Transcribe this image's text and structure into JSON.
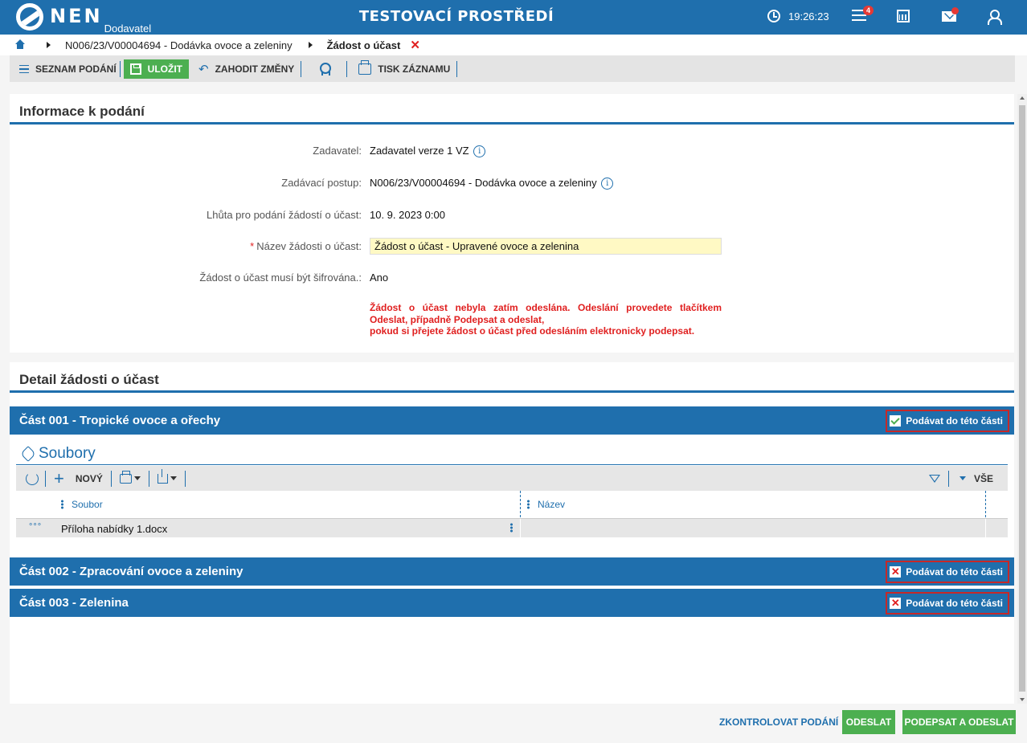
{
  "header": {
    "logo_text": "NEN",
    "logo_sub": "Dodavatel",
    "env_title": "TESTOVACÍ PROSTŘEDÍ",
    "time": "19:26:23",
    "notification_count": "4"
  },
  "breadcrumb": {
    "link": "N006/23/V00004694 - Dodávka ovoce a zeleniny",
    "current": "Žádost o účast"
  },
  "toolbar": {
    "list": "SEZNAM PODÁNÍ",
    "save": "ULOŽIT",
    "discard": "ZAHODIT ZMĚNY",
    "print": "TISK ZÁZNAMU"
  },
  "info_panel": {
    "title": "Informace k podání",
    "rows": [
      {
        "label": "Zadavatel:",
        "value": "Zadavatel verze 1 VZ"
      },
      {
        "label": "Zadávací postup:",
        "value": "N006/23/V00004694 - Dodávka ovoce a zeleniny"
      },
      {
        "label": "Lhůta pro podání žádostí o účast:",
        "value": "10. 9. 2023 0:00"
      },
      {
        "label": "Název žádosti o účast:",
        "value": "Žádost o účast - Upravené ovoce a zelenina"
      },
      {
        "label": "Žádost o účast musí být šifrována.:",
        "value": "Ano"
      }
    ],
    "required_mark": "*",
    "warning": [
      "Žádost o účast nebyla zatím odeslána. Odeslání provedete tlačítkem",
      "Odeslat, případně Podepsat a odeslat,",
      "pokud si přejete žádost o účast před odesláním elektronicky podepsat."
    ]
  },
  "detail_panel": {
    "title": "Detail žádosti o účast",
    "parts": [
      {
        "title": "Část 001 - Tropické ovoce a ořechy",
        "check_label": "Podávat do této části",
        "checked": true
      },
      {
        "title": "Část 002 - Zpracování ovoce a zeleniny",
        "check_label": "Podávat do této části",
        "checked": false
      },
      {
        "title": "Část 003 - Zelenina",
        "check_label": "Podávat do této části",
        "checked": false
      }
    ],
    "files": {
      "title": "Soubory",
      "new_label": "NOVÝ",
      "all_label": "VŠE",
      "columns": [
        "Soubor",
        "Název"
      ],
      "rows": [
        {
          "file": "Příloha nabídky 1.docx",
          "name": ""
        }
      ],
      "row_menu": "°°°"
    }
  },
  "footer": {
    "check": "ZKONTROLOVAT PODÁNÍ",
    "send": "ODESLAT",
    "sign_send": "PODEPSAT A ODESLAT"
  },
  "colors": {
    "primary": "#1f6fad",
    "success": "#4caf50",
    "danger": "#e02020",
    "input_highlight": "#fff9c4"
  }
}
